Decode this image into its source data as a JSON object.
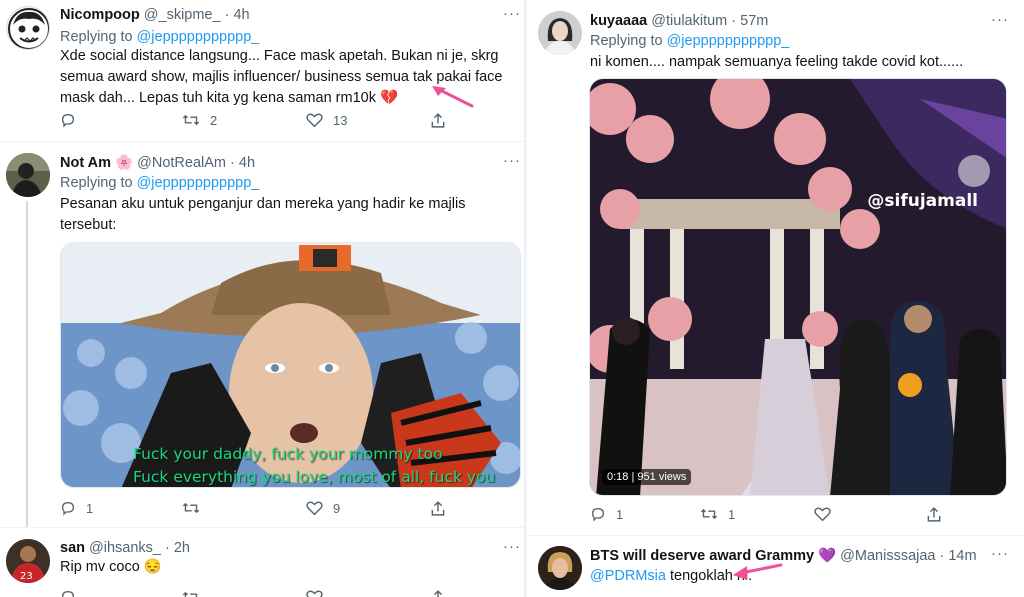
{
  "left": {
    "tweets": [
      {
        "name": "Nicompoop",
        "handle": "@_skipme_",
        "time": "· 4h",
        "replying_prefix": "Replying to",
        "replying_handle": "@jeppppppppppp_",
        "text": "Xde social distance langsung... Face mask apetah. Bukan ni je, skrg semua award show, majlis influencer/ business semua tak pakai face mask dah... Lepas tuh kita yg kena saman rm10k",
        "emoji": "💔",
        "replies": "",
        "retweets": "2",
        "likes": "13"
      },
      {
        "name": "Not Am",
        "badge_emoji": "🌸",
        "handle": "@NotRealAm",
        "time": "· 4h",
        "replying_prefix": "Replying to",
        "replying_handle": "@jeppppppppppp_",
        "text": "Pesanan aku untuk penganjur dan mereka yang hadir ke majlis tersebut:",
        "media_caption_1": "Fuck your daddy, fuck your mommy too",
        "media_caption_2": "Fuck everything you love, most of all, fuck you",
        "replies": "1",
        "retweets": "",
        "likes": "9"
      },
      {
        "name": "san",
        "handle": "@ihsanks_",
        "time": "· 2h",
        "text": "Rip mv coco",
        "emoji": "😔"
      }
    ]
  },
  "right": {
    "tweets": [
      {
        "name": "kuyaaaa",
        "handle": "@tiulakitum",
        "time": "· 57m",
        "replying_prefix": "Replying to",
        "replying_handle": "@jeppppppppppp_",
        "text": "ni komen.... nampak semuanya feeling takde covid kot......",
        "video_watermark": "@sifujamall",
        "video_time": "0:18",
        "video_views": "951 views",
        "replies": "1",
        "retweets": "1",
        "likes": ""
      },
      {
        "name": "BTS will deserve award Grammy",
        "badge_emoji": "💜",
        "handle": "@Manisssajaa",
        "time": "· 14m",
        "mention": "@PDRMsia",
        "text": " tengoklah ni."
      }
    ]
  },
  "colors": {
    "link": "#1d9bf0",
    "muted": "#536471",
    "annotation_arrow": "#f0509a"
  }
}
